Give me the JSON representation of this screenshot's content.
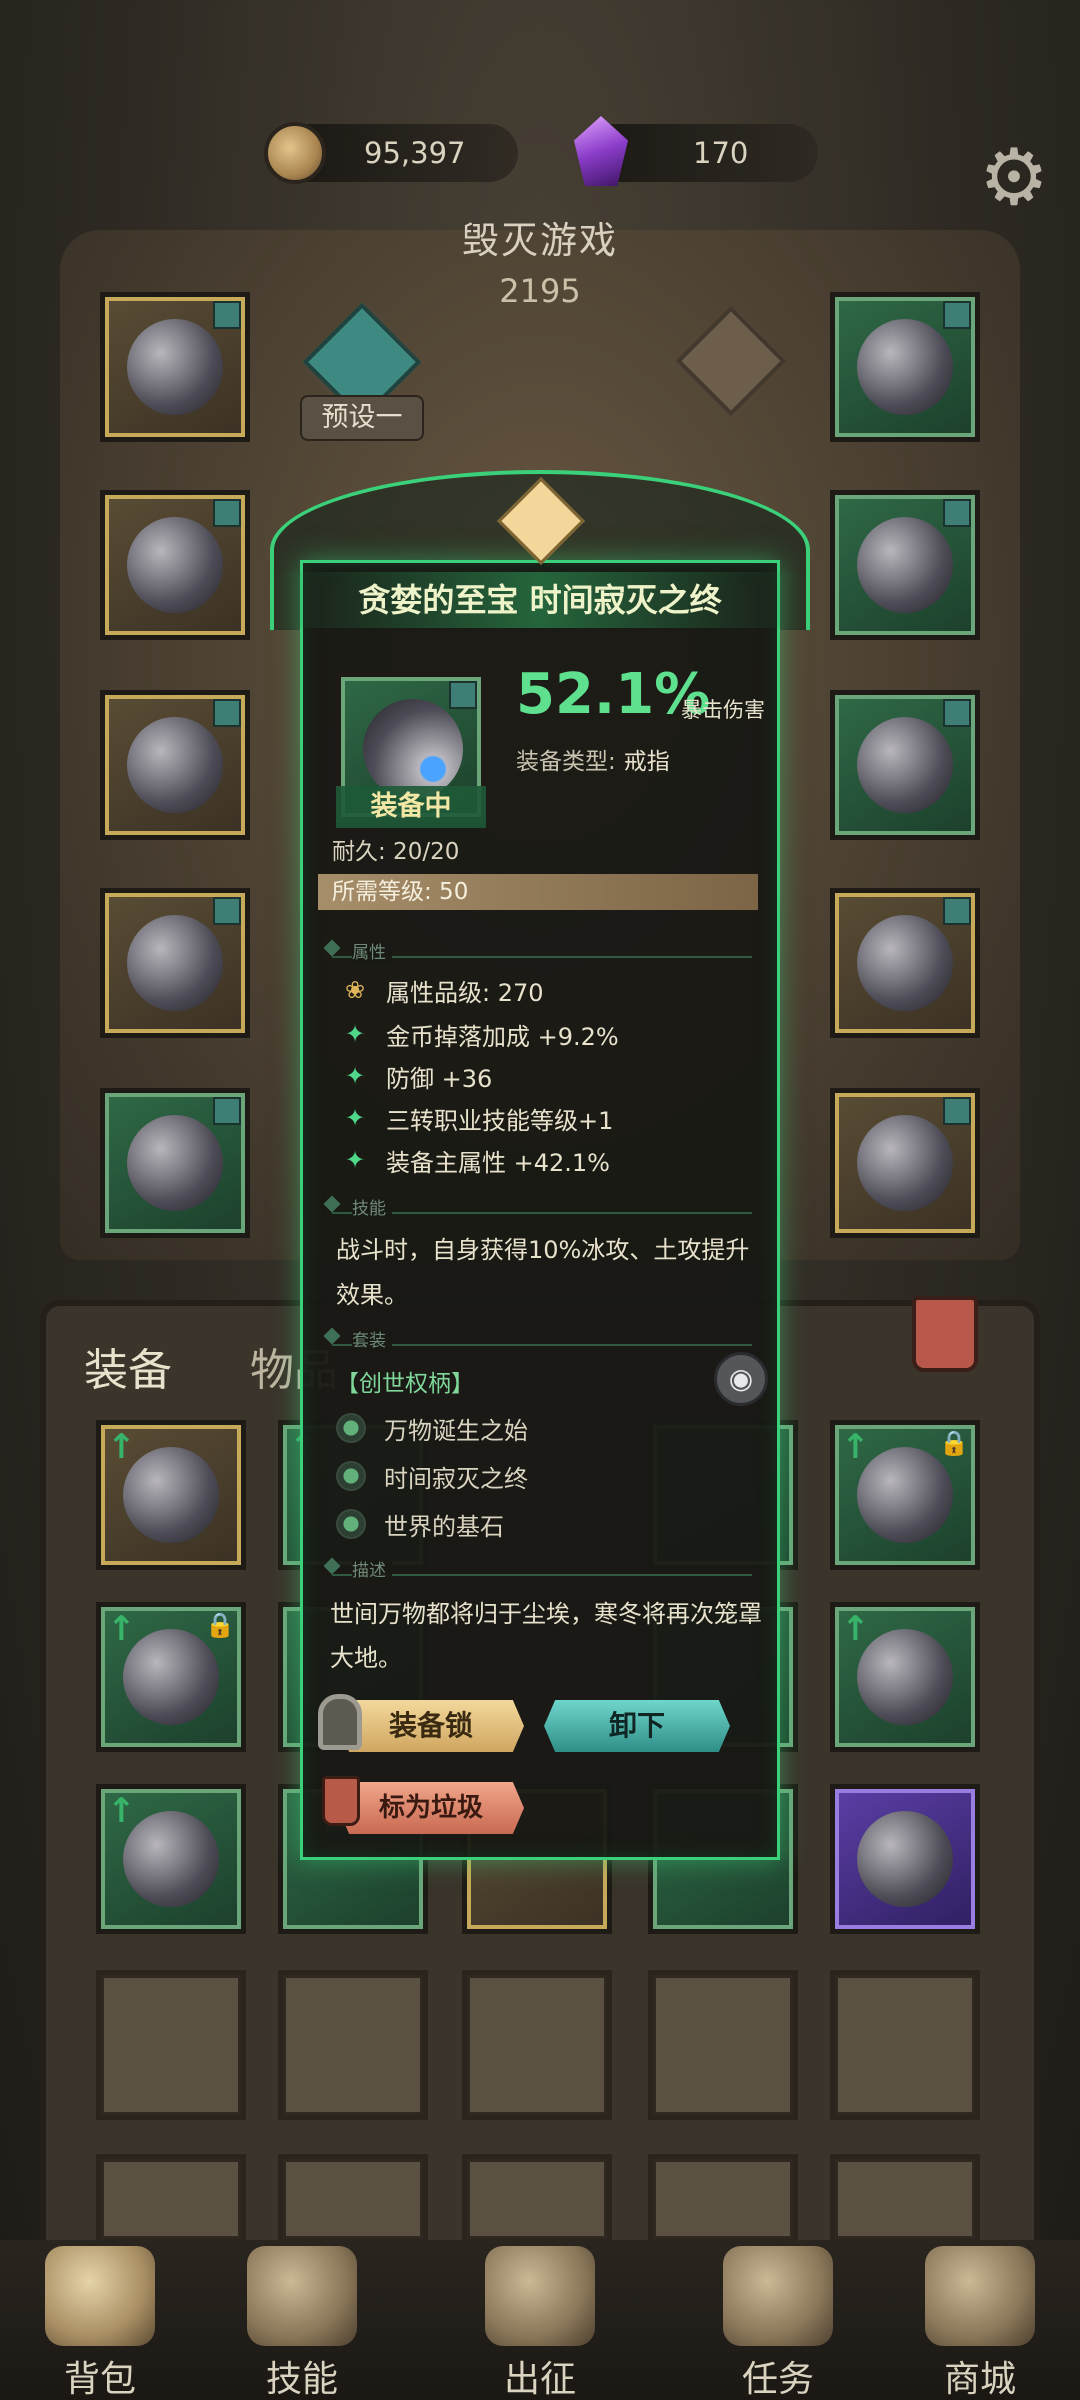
{
  "currencies": {
    "gold": "95,397",
    "gem": "170"
  },
  "header": {
    "title": "毁灭游戏",
    "power": "2195",
    "preset": "预设一"
  },
  "tabs": {
    "equipment": "装备",
    "items": "物品"
  },
  "tooltip": {
    "title": "贪婪的至宝 时间寂灭之终",
    "main_stat_value": "52.1%",
    "main_stat_label": "暴击伤害",
    "type_label": "装备类型:",
    "type_value": "戒指",
    "equipped": "装备中",
    "durability": "耐久: 20/20",
    "required_level": "所需等级: 50",
    "section_attributes": "属性",
    "attributes": [
      "属性品级: 270",
      "金币掉落加成 +9.2%",
      "防御 +36",
      "三转职业技能等级+1",
      "装备主属性 +42.1%"
    ],
    "section_skill": "技能",
    "skill_text": "战斗时，自身获得10%冰攻、土攻提升效果。",
    "section_set": "套装",
    "set_name": "【创世权柄】",
    "set_items": [
      "万物诞生之始",
      "时间寂灭之终",
      "世界的基石"
    ],
    "section_desc": "描述",
    "description": "世间万物都将归于尘埃，寒冬将再次笼罩大地。",
    "buttons": {
      "lock": "装备锁",
      "unequip": "卸下",
      "mark_trash": "标为垃圾"
    }
  },
  "nav": {
    "items": [
      "背包",
      "技能",
      "出征",
      "任务",
      "商城"
    ]
  },
  "colors": {
    "accent_green": "#3bd07a",
    "stat_green": "#5fe08e"
  }
}
